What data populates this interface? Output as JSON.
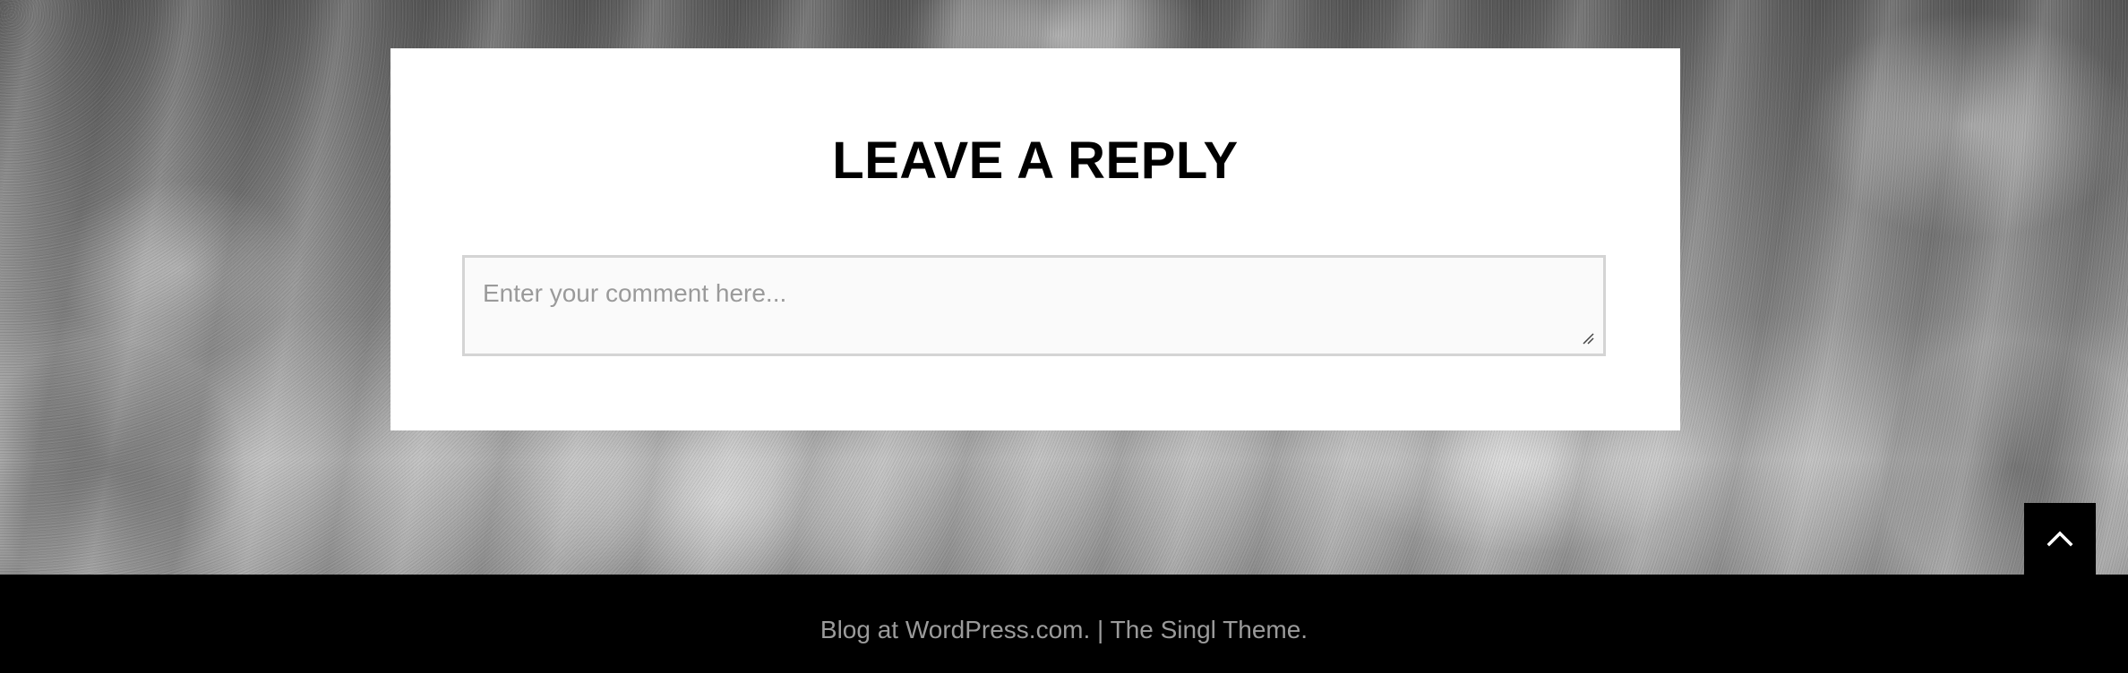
{
  "reply": {
    "heading": "LEAVE A REPLY",
    "comment_placeholder": "Enter your comment here..."
  },
  "footer": {
    "blog_link": "Blog at WordPress.com.",
    "separator": " | ",
    "theme_link": "The Singl Theme."
  },
  "back_to_top": {
    "icon": "chevron-up-icon"
  },
  "colors": {
    "footer_bg": "#000000",
    "footer_text": "#9b9b9b",
    "card_bg": "#ffffff",
    "input_border": "#d4d4d4"
  }
}
